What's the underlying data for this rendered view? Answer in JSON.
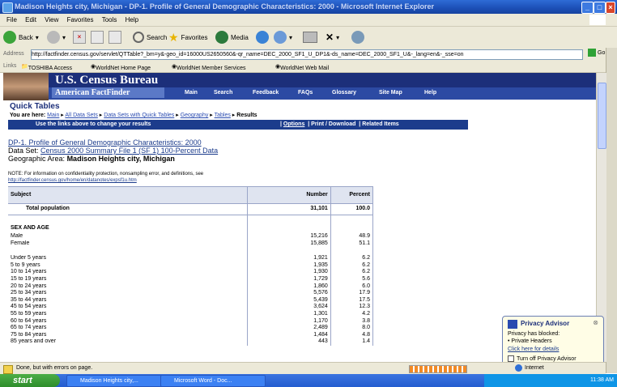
{
  "window": {
    "title": "Madison Heights city, Michigan - DP-1. Profile of General Demographic Characteristics: 2000 - Microsoft Internet Explorer"
  },
  "menu": [
    "File",
    "Edit",
    "View",
    "Favorites",
    "Tools",
    "Help"
  ],
  "toolbar": {
    "back": "Back",
    "search": "Search",
    "favorites": "Favorites",
    "media": "Media"
  },
  "address": {
    "label": "Address",
    "url": "http://factfinder.census.gov/servlet/QTTable?_bm=y&-geo_id=16000US2650560&-qr_name=DEC_2000_SF1_U_DP1&-ds_name=DEC_2000_SF1_U&-_lang=en&-_sse=on",
    "go": "Go"
  },
  "links": {
    "label": "Links",
    "items": [
      "TOSHIBA Access",
      "WorldNet Home Page",
      "WorldNet Member Services",
      "WorldNet Web Mail"
    ]
  },
  "census": {
    "title": "U.S. Census Bureau",
    "brand": "American FactFinder",
    "nav": [
      "Main",
      "Search",
      "Feedback",
      "FAQs",
      "Glossary",
      "Site Map",
      "Help"
    ],
    "quick_tables": "Quick Tables",
    "breadcrumb": {
      "prefix": "You are here:",
      "links": [
        "Main",
        "All Data Sets",
        "Data Sets with Quick Tables",
        "Geography",
        "Tables"
      ],
      "current": "Results"
    },
    "instruction": "Use the links above to change your results",
    "actions": [
      "Options",
      "Print / Download",
      "Related Items"
    ]
  },
  "report": {
    "title": "DP-1. Profile of General Demographic Characteristics: 2000",
    "dataset_label": "Data Set:",
    "dataset": "Census 2000 Summary File 1 (SF 1) 100-Percent Data",
    "geo_label": "Geographic Area:",
    "geo": "Madison Heights city, Michigan",
    "note": "NOTE: For information on confidentiality protection, nonsampling error, and definitions, see",
    "note_link": "http://factfinder.census.gov/home/en/datanotes/expsf1u.htm"
  },
  "table": {
    "headers": [
      "Subject",
      "Number",
      "Percent"
    ],
    "total": [
      "Total population",
      "31,101",
      "100.0"
    ],
    "section": "SEX AND AGE",
    "sex_rows": [
      [
        "Male",
        "15,216",
        "48.9"
      ],
      [
        "Female",
        "15,885",
        "51.1"
      ]
    ],
    "age_rows": [
      [
        "Under 5 years",
        "1,921",
        "6.2"
      ],
      [
        "5 to 9 years",
        "1,935",
        "6.2"
      ],
      [
        "10 to 14 years",
        "1,930",
        "6.2"
      ],
      [
        "15 to 19 years",
        "1,729",
        "5.6"
      ],
      [
        "20 to 24 years",
        "1,860",
        "6.0"
      ],
      [
        "25 to 34 years",
        "5,576",
        "17.9"
      ],
      [
        "35 to 44 years",
        "5,439",
        "17.5"
      ],
      [
        "45 to 54 years",
        "3,624",
        "12.3"
      ],
      [
        "55 to 59 years",
        "1,301",
        "4.2"
      ],
      [
        "60 to 64 years",
        "1,170",
        "3.8"
      ],
      [
        "65 to 74 years",
        "2,489",
        "8.0"
      ],
      [
        "75 to 84 years",
        "1,484",
        "4.8"
      ],
      [
        "85 years and over",
        "443",
        "1.4"
      ]
    ]
  },
  "privacy": {
    "title": "Privacy Advisor",
    "line1": "Privacy has blocked:",
    "line2": "• Private Headers",
    "link": "Click here for details",
    "checkbox": "Turn off Privacy Advisor"
  },
  "status": {
    "text": "Done, but with errors on page.",
    "zone": "Internet"
  },
  "taskbar": {
    "start": "start",
    "tasks": [
      "Madison Heights city,...",
      "Microsoft Word - Doc..."
    ],
    "clock": "11:38 AM"
  }
}
